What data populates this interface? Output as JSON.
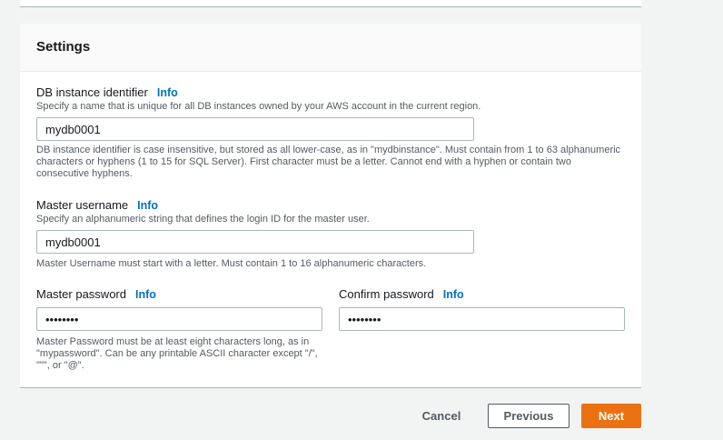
{
  "settings": {
    "title": "Settings",
    "info_label": "Info",
    "db_identifier": {
      "label": "DB instance identifier",
      "description": "Specify a name that is unique for all DB instances owned by your AWS account in the current region.",
      "value": "mydb0001",
      "constraint_lines": [
        "DB instance identifier is case insensitive, but stored as all lower-case, as in \"mydbinstance\". Must contain from 1 to 63 alphanumeric",
        "characters or hyphens (1 to 15 for SQL Server). First character must be a letter. Cannot end with a hyphen or contain two",
        "consecutive hyphens."
      ]
    },
    "master_username": {
      "label": "Master username",
      "description": "Specify an alphanumeric string that defines the login ID for the master user.",
      "value": "mydb0001",
      "constraint": "Master Username must start with a letter. Must contain 1 to 16 alphanumeric characters."
    },
    "master_password": {
      "label": "Master password",
      "value": "••••••••",
      "constraint_lines": [
        "Master Password must be at least eight characters long, as in",
        "\"mypassword\". Can be any printable ASCII character except \"/\",",
        "\"\"\", or \"@\"."
      ]
    },
    "confirm_password": {
      "label": "Confirm password",
      "value": "••••••••"
    }
  },
  "footer": {
    "cancel_label": "Cancel",
    "previous_label": "Previous",
    "next_label": "Next"
  },
  "colors": {
    "accent_orange": "#ec7211",
    "info_link": "#0073bb",
    "text_primary": "#16191f",
    "text_secondary": "#545b64"
  }
}
